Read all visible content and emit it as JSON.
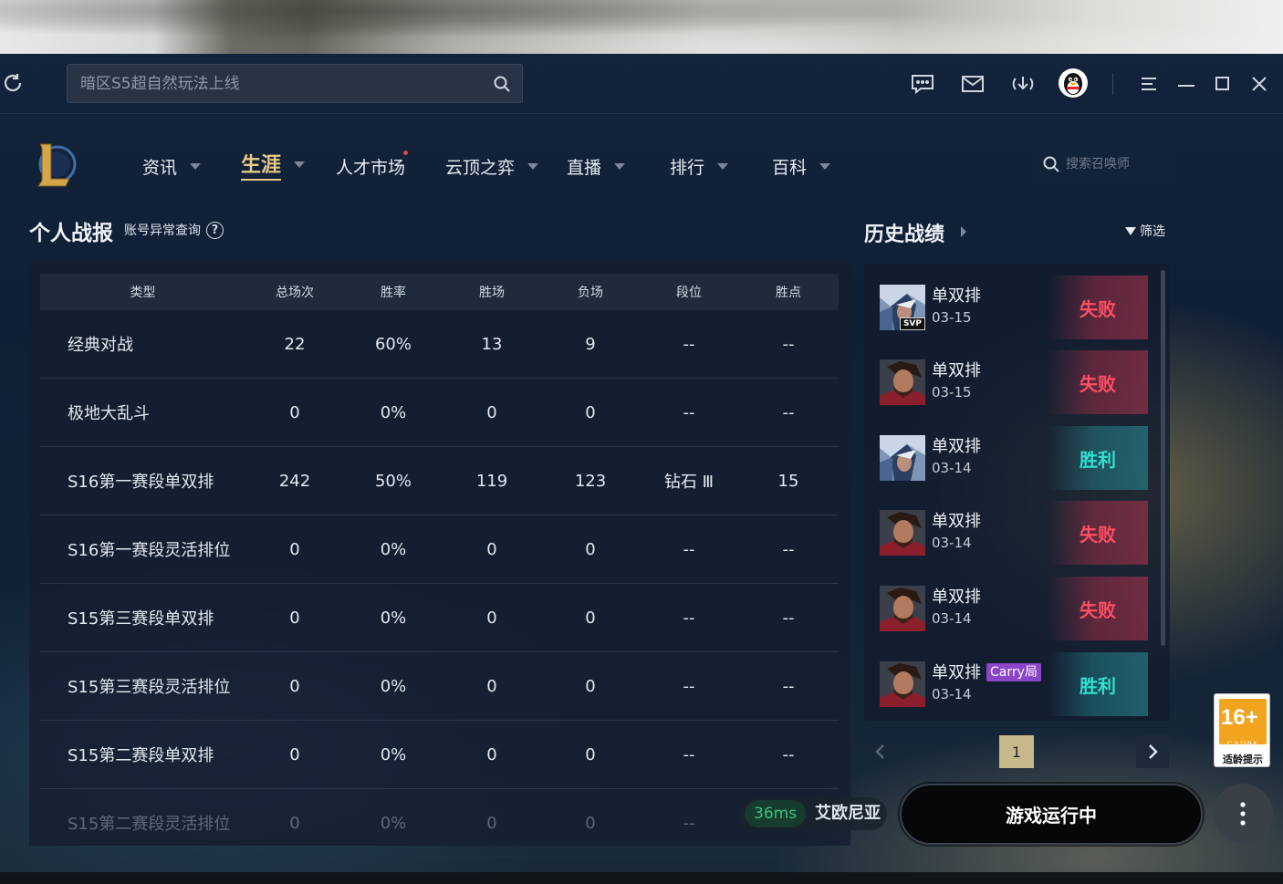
{
  "titlebar": {
    "search_placeholder": "暗区S5超自然玩法上线",
    "icons": [
      "refresh-icon",
      "search-icon",
      "chat-icon",
      "mail-icon",
      "download-icon",
      "qq-avatar",
      "menu-icon",
      "minimize-icon",
      "maximize-icon",
      "close-icon"
    ]
  },
  "nav": {
    "items": [
      {
        "label": "资讯",
        "has_caret": true
      },
      {
        "label": "生涯",
        "has_caret": true,
        "active": true
      },
      {
        "label": "人才市场",
        "has_caret": false,
        "red_dot": true
      },
      {
        "label": "云顶之弈",
        "has_caret": true
      },
      {
        "label": "直播",
        "has_caret": true
      },
      {
        "label": "排行",
        "has_caret": true
      },
      {
        "label": "百科",
        "has_caret": true
      }
    ],
    "search_placeholder": "搜索召唤师"
  },
  "stats": {
    "title": "个人战报",
    "link": "账号异常查询",
    "headers": [
      "类型",
      "总场次",
      "胜率",
      "胜场",
      "负场",
      "段位",
      "胜点"
    ],
    "rows": [
      [
        "经典对战",
        "22",
        "60%",
        "13",
        "9",
        "--",
        "--"
      ],
      [
        "极地大乱斗",
        "0",
        "0%",
        "0",
        "0",
        "--",
        "--"
      ],
      [
        "S16第一赛段单双排",
        "242",
        "50%",
        "119",
        "123",
        "钻石 Ⅲ",
        "15"
      ],
      [
        "S16第一赛段灵活排位",
        "0",
        "0%",
        "0",
        "0",
        "--",
        "--"
      ],
      [
        "S15第三赛段单双排",
        "0",
        "0%",
        "0",
        "0",
        "--",
        "--"
      ],
      [
        "S15第三赛段灵活排位",
        "0",
        "0%",
        "0",
        "0",
        "--",
        "--"
      ],
      [
        "S15第二赛段单双排",
        "0",
        "0%",
        "0",
        "0",
        "--",
        "--"
      ],
      [
        "S15第二赛段灵活排位",
        "0",
        "0%",
        "0",
        "0",
        "--",
        "--"
      ]
    ]
  },
  "history": {
    "title": "历史战绩",
    "filter_label": "筛选",
    "matches": [
      {
        "mode": "单双排",
        "date": "03-15",
        "result": "失败",
        "outcome": "lose",
        "champ": "blue-champ",
        "badge": "SVP"
      },
      {
        "mode": "单双排",
        "date": "03-15",
        "result": "失败",
        "outcome": "lose",
        "champ": "red-champ"
      },
      {
        "mode": "单双排",
        "date": "03-14",
        "result": "胜利",
        "outcome": "win",
        "champ": "blue-champ"
      },
      {
        "mode": "单双排",
        "date": "03-14",
        "result": "失败",
        "outcome": "lose",
        "champ": "red-champ"
      },
      {
        "mode": "单双排",
        "date": "03-14",
        "result": "失败",
        "outcome": "lose",
        "champ": "red-champ"
      },
      {
        "mode": "单双排",
        "date": "03-14",
        "result": "胜利",
        "outcome": "win",
        "champ": "red-champ",
        "tag": "Carry局"
      }
    ],
    "page": "1"
  },
  "bottom": {
    "ping": "36ms",
    "server": "艾欧尼亚",
    "play_label": "游戏运行中",
    "age_rating": "16+",
    "age_org": "CADPA",
    "age_tip": "适龄提示"
  },
  "colors": {
    "accent_gold": "#e8c98a",
    "lose": "#ff4e63",
    "win": "#33e0cf",
    "ping_green": "#35c47c",
    "carry_purple": "#8b45c9"
  }
}
